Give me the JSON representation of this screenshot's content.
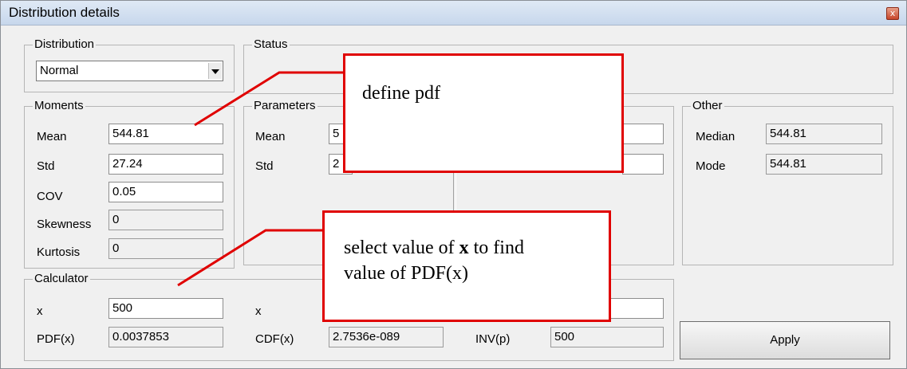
{
  "window": {
    "title": "Distribution details",
    "close_glyph": "x"
  },
  "distribution": {
    "label": "Distribution",
    "selected": "Normal"
  },
  "status": {
    "label": "Status"
  },
  "moments": {
    "label": "Moments",
    "rows": [
      {
        "name": "Mean",
        "value": "544.81",
        "readonly": false
      },
      {
        "name": "Std",
        "value": "27.24",
        "readonly": false
      },
      {
        "name": "COV",
        "value": "0.05",
        "readonly": false
      },
      {
        "name": "Skewness",
        "value": "0",
        "readonly": true
      },
      {
        "name": "Kurtosis",
        "value": "0",
        "readonly": true
      }
    ]
  },
  "parameters": {
    "label": "Parameters",
    "rows": [
      {
        "name": "Mean",
        "value": "5"
      },
      {
        "name": "Std",
        "value": "2"
      }
    ]
  },
  "other": {
    "label": "Other",
    "rows": [
      {
        "name": "Median",
        "value": "544.81"
      },
      {
        "name": "Mode",
        "value": "544.81"
      }
    ]
  },
  "calculator": {
    "label": "Calculator",
    "x_label": "x",
    "x_value": "500",
    "x2_label": "x",
    "pdf_label": "PDF(x)",
    "pdf_value": "0.0037853",
    "cdf_label": "CDF(x)",
    "cdf_value": "2.7536e-089",
    "inv_label": "INV(p)",
    "inv_value": "500"
  },
  "apply_button": "Apply",
  "annotations": {
    "define": "define pdf",
    "select_line1": "select value of ",
    "select_bold": "x",
    "select_line1_end": " to find",
    "select_line2": "value of PDF(x)"
  },
  "colors": {
    "annotation_border": "#e00000",
    "panel_bg": "#f0f0f0"
  }
}
